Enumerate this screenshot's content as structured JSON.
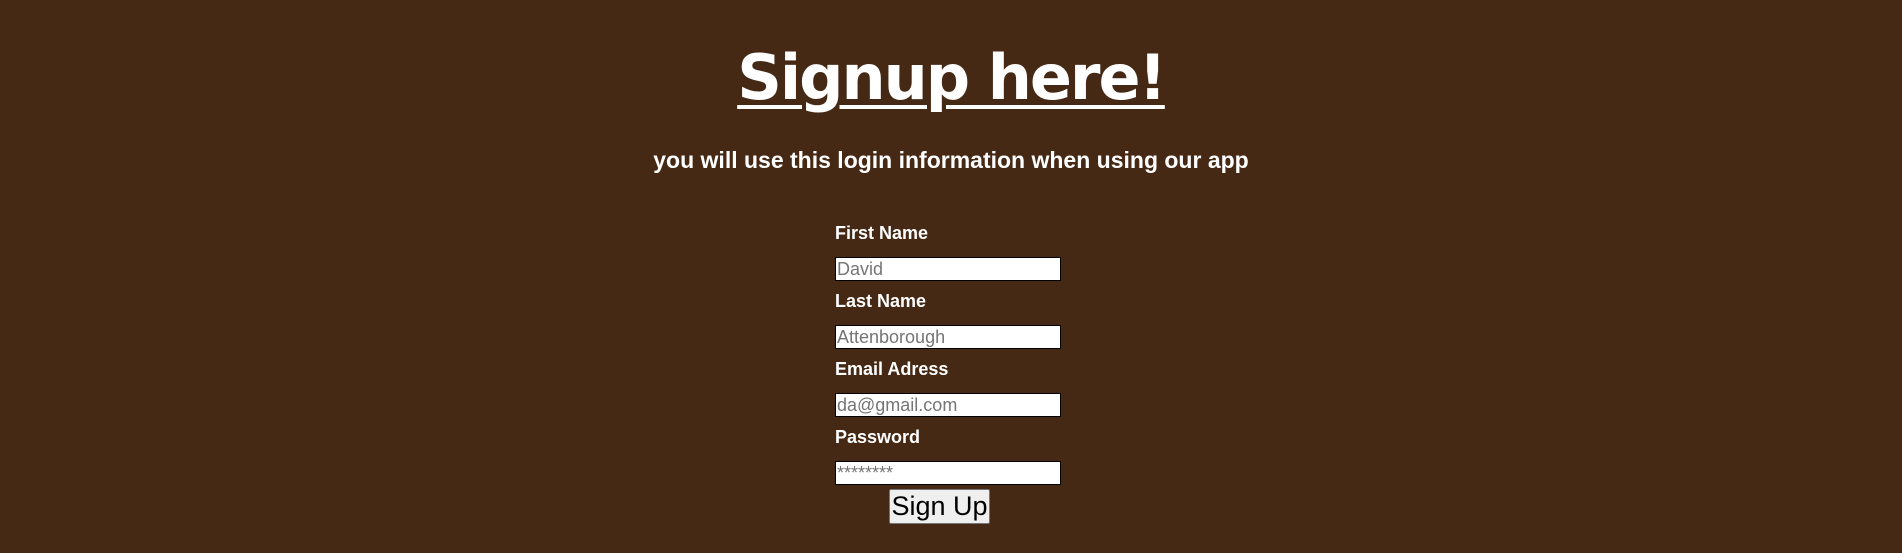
{
  "page": {
    "title": "Signup here!",
    "subtitle": "you will use this login information when using our app",
    "background_color": "#452915"
  },
  "form": {
    "fields": [
      {
        "label": "First Name",
        "placeholder": "David",
        "value": ""
      },
      {
        "label": "Last Name",
        "placeholder": "Attenborough",
        "value": ""
      },
      {
        "label": "Email Adress",
        "placeholder": "da@gmail.com",
        "value": ""
      },
      {
        "label": "Password",
        "placeholder": "********",
        "value": ""
      }
    ],
    "submit_label": "Sign Up"
  }
}
